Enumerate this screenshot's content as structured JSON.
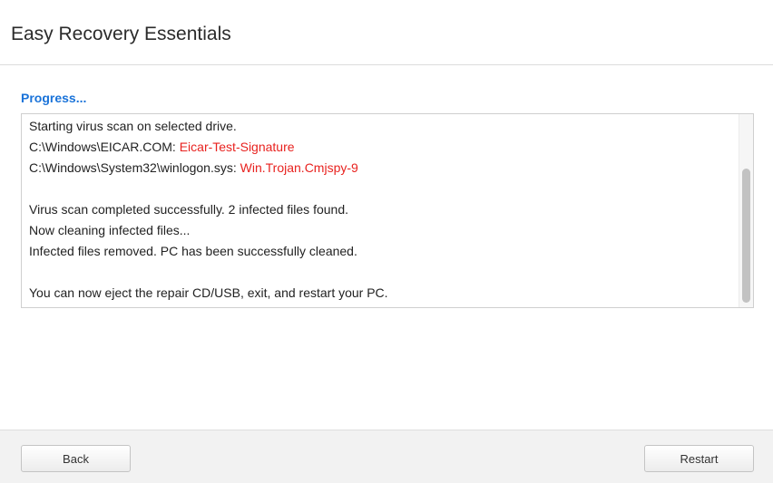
{
  "window": {
    "title": "Easy Recovery Essentials"
  },
  "progress": {
    "label": "Progress..."
  },
  "log": {
    "line1": "Starting virus scan on selected drive.",
    "infection1_path": "C:\\Windows\\EICAR.COM: ",
    "infection1_threat": "Eicar-Test-Signature",
    "infection2_path": "C:\\Windows\\System32\\winlogon.sys: ",
    "infection2_threat": "Win.Trojan.Cmjspy-9",
    "line_completed": "Virus scan completed successfully. 2 infected files found.",
    "line_cleaning": "Now cleaning infected files...",
    "line_removed": "Infected files removed. PC has been successfully cleaned.",
    "line_eject": "You can now eject the repair CD/USB, exit, and restart your PC."
  },
  "footer": {
    "back_label": "Back",
    "restart_label": "Restart"
  },
  "colors": {
    "accent": "#1a73d9",
    "threat": "#e8221f"
  }
}
